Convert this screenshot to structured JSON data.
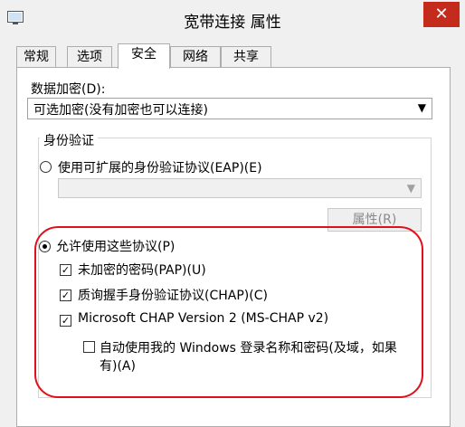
{
  "window": {
    "title": "宽带连接 属性",
    "close_glyph": "✕"
  },
  "tabs": [
    {
      "label": "常规",
      "active": false
    },
    {
      "label": "选项",
      "active": false
    },
    {
      "label": "安全",
      "active": true
    },
    {
      "label": "网络",
      "active": false
    },
    {
      "label": "共享",
      "active": false
    }
  ],
  "encryption": {
    "label": "数据加密(D):",
    "selected": "可选加密(没有加密也可以连接)"
  },
  "auth": {
    "group_title": "身份验证",
    "eap_radio_label": "使用可扩展的身份验证协议(EAP)(E)",
    "eap_radio_checked": false,
    "eap_combo_value": "",
    "properties_button": "属性(R)",
    "allow_radio_label": "允许使用这些协议(P)",
    "allow_radio_checked": true,
    "protocols": [
      {
        "label": "未加密的密码(PAP)(U)",
        "checked": true
      },
      {
        "label": "质询握手身份验证协议(CHAP)(C)",
        "checked": true
      },
      {
        "label": "Microsoft CHAP Version 2 (MS-CHAP v2)",
        "checked": true
      }
    ],
    "auto_logon_line1": "自动使用我的 Windows 登录名称和密码(及域，如果",
    "auto_logon_line2": "有)(A)",
    "auto_logon_checked": false
  },
  "highlight_color": "#e0101a",
  "icons": {
    "app": "network-connection-icon",
    "dropdown": "chevron-down-icon"
  }
}
